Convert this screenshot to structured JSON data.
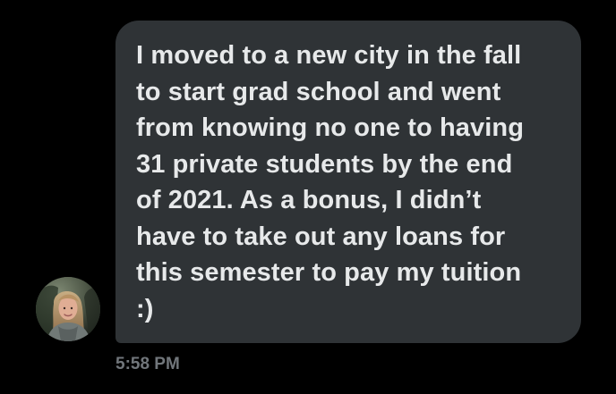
{
  "message": {
    "text": "I moved to a new city in the fall\nto start grad school and went\nfrom knowing no one to having\n31 private students by the end\nof 2021. As a bonus, I didn’t\nhave to take out any loans for\nthis semester to pay my tuition\n:)",
    "timestamp": "5:58 PM",
    "sender_avatar": "user-avatar"
  },
  "colors": {
    "background": "#000000",
    "bubble": "#2f3336",
    "text": "#e7e9ea",
    "timestamp": "#71767b"
  }
}
